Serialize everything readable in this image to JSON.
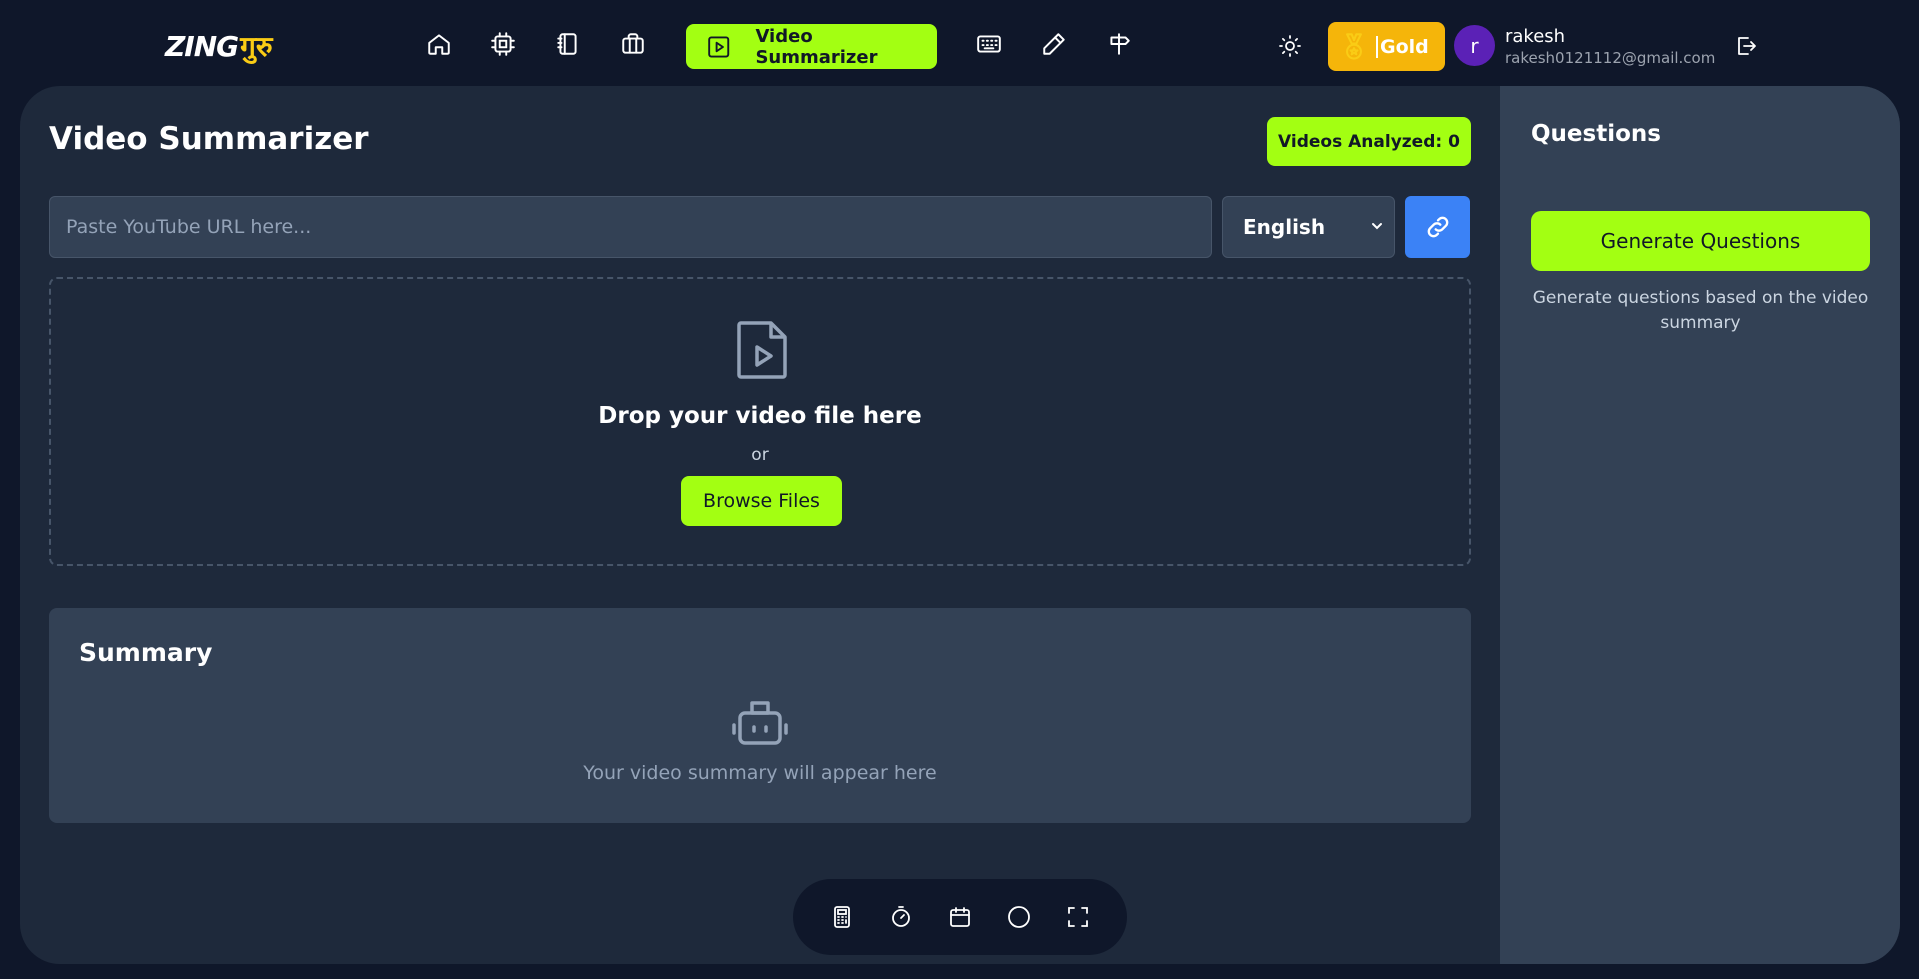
{
  "brand": {
    "logo_latin": "ZING",
    "logo_devanagari": "गुरु"
  },
  "nav": {
    "active_label": "Video Summarizer",
    "icons": [
      "home-icon",
      "cpu-icon",
      "notebook-icon",
      "briefcase-icon",
      "video-play-icon",
      "keyboard-icon",
      "pencil-icon",
      "signpost-icon"
    ]
  },
  "header": {
    "badge_label": "Gold",
    "user_initial": "r",
    "user_name": "rakesh",
    "user_email": "rakesh0121112@gmail.com"
  },
  "main": {
    "title": "Video Summarizer",
    "analyzed_label": "Videos Analyzed: 0",
    "url_placeholder": "Paste YouTube URL here...",
    "language_selected": "English",
    "dropzone_title": "Drop your video file here",
    "dropzone_or": "or",
    "browse_label": "Browse Files",
    "summary_title": "Summary",
    "summary_empty": "Your video summary will appear here"
  },
  "questions": {
    "title": "Questions",
    "generate_label": "Generate Questions",
    "hint": "Generate questions based on the video summary"
  },
  "toolbar": {
    "icons": [
      "calculator-icon",
      "stopwatch-icon",
      "calendar-icon",
      "circle-icon",
      "fullscreen-icon"
    ]
  },
  "colors": {
    "accent": "#a3ff12",
    "gold": "#f5b50a",
    "link_button": "#3b82f6",
    "avatar": "#5b21b6"
  }
}
